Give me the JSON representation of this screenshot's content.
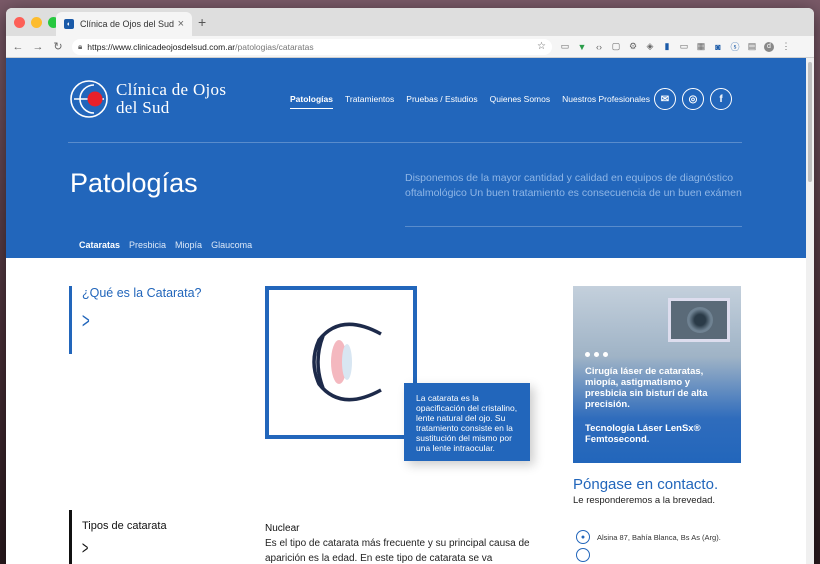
{
  "browser": {
    "tab_title": "Clínica de Ojos del Sud",
    "tab_close": "×",
    "new_tab": "+",
    "url_host": "https://www.clinicadeojosdelsud.com.ar",
    "url_path": "/patologias/cataratas",
    "profile_initial": "d"
  },
  "site": {
    "logo_line1": "Clínica de Ojos",
    "logo_line2": "del Sud",
    "nav": [
      {
        "label": "Patologías"
      },
      {
        "label": "Tratamientos"
      },
      {
        "label": "Pruebas / Estudios"
      },
      {
        "label": "Quienes Somos"
      },
      {
        "label": "Nuestros Profesionales"
      }
    ],
    "social": {
      "mail": "✉",
      "instagram": "◎",
      "facebook": "f"
    }
  },
  "hero": {
    "title": "Patologías",
    "description": "Disponemos de la mayor cantidad y calidad en equipos de diagnóstico oftalmológico Un buen tratamiento es consecuencia de un buen exámen",
    "subnav": [
      {
        "label": "Cataratas"
      },
      {
        "label": "Presbicia"
      },
      {
        "label": "Miopía"
      },
      {
        "label": "Glaucoma"
      }
    ]
  },
  "content": {
    "what_title": "¿Qué es la Catarata?",
    "caption": "La catarata es la opacificación del cristalino, lente natural del ojo. Su tratamiento consiste en la sustitución del mismo por una lente intraocular.",
    "promo_text": "Cirugía láser de cataratas, miopía, astigmatismo y presbicia sin bisturí de alta precisión.",
    "promo_tech": "Tecnología Láser LenSx® Femtosecond.",
    "contact_title": "Póngase en contacto.",
    "contact_sub": "Le responderemos a la brevedad.",
    "address": "Alsina 87, Bahía Blanca, Bs As (Arg).",
    "types_title": "Tipos de catarata",
    "nuclear_title": "Nuclear",
    "nuclear_text": "Es el tipo de catarata más frecuente y su principal causa de aparición es la edad. En este tipo de catarata se va"
  },
  "colors": {
    "brand_blue": "#2266bb",
    "logo_red": "#e8202a"
  }
}
